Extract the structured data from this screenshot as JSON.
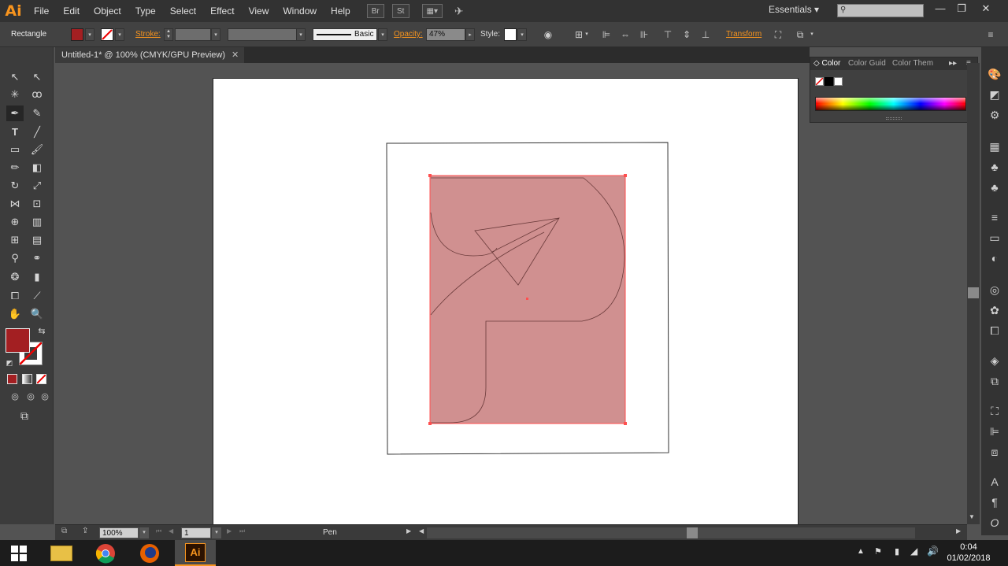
{
  "app": {
    "logo": "Ai",
    "name": "Adobe Illustrator"
  },
  "menu": [
    "File",
    "Edit",
    "Object",
    "Type",
    "Select",
    "Effect",
    "View",
    "Window",
    "Help"
  ],
  "menubar_buttons": {
    "bridge": "Br",
    "stock": "St"
  },
  "workspace": {
    "label": "Essentials ▾",
    "search_placeholder": ""
  },
  "window_controls": {
    "minimize": "—",
    "restore": "❐",
    "close": "✕"
  },
  "control": {
    "selection_type": "Rectangle",
    "fill_color": "#a31f22",
    "stroke_label": "Stroke:",
    "brush_label": "Basic",
    "opacity_label": "Opacity:",
    "opacity_value": "47%",
    "style_label": "Style:",
    "transform_label": "Transform"
  },
  "document": {
    "tab_title": "Untitled-1* @ 100% (CMYK/GPU Preview)",
    "close": "✕"
  },
  "color_panel": {
    "tabs": [
      "Color",
      "Color Guid",
      "Color Them"
    ]
  },
  "status": {
    "zoom": "100%",
    "artboard": "1",
    "tool": "Pen"
  },
  "taskbar": {
    "time": "0:04",
    "date": "01/02/2018",
    "ai_label": "Ai"
  },
  "colors": {
    "accent": "#f7941e",
    "fill": "#a31f22",
    "selection": "#ff4f4f",
    "shape_fill": "#d09090"
  }
}
